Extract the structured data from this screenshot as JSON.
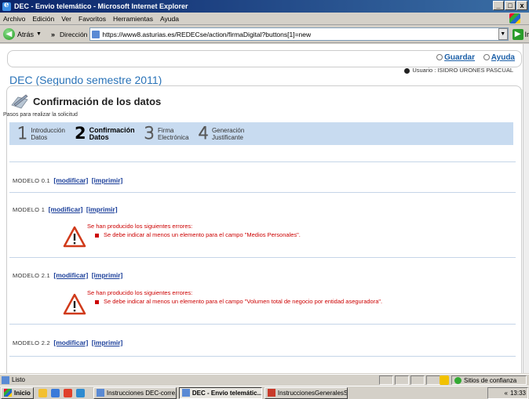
{
  "window": {
    "title": "DEC - Envio telemático - Microsoft Internet Explorer",
    "controls": {
      "minimize": "_",
      "maximize": "□",
      "close": "x"
    }
  },
  "menu": [
    "Archivo",
    "Edición",
    "Ver",
    "Favoritos",
    "Herramientas",
    "Ayuda"
  ],
  "toolbar": {
    "back_label": "Atrás",
    "more": "»",
    "address_label": "Dirección",
    "url": "https://www8.asturias.es/REDECse/action/firmaDigital?buttons[1]=new",
    "go_label": "Ir"
  },
  "page": {
    "top_links": {
      "save": "Guardar",
      "help": "Ayuda"
    },
    "user": "Usuario : ISIDRO URONES PASCUAL",
    "app_title": "DEC (Segundo semestre 2011)",
    "section_title": "Confirmación de los datos",
    "steps_caption": "Pasos para realizar la solicitud",
    "steps": [
      {
        "num": "1",
        "line1": "Introducción",
        "line2": "Datos"
      },
      {
        "num": "2",
        "line1": "Confirmación",
        "line2": "Datos"
      },
      {
        "num": "3",
        "line1": "Firma",
        "line2": "Electrónica"
      },
      {
        "num": "4",
        "line1": "Generación",
        "line2": "Justificante"
      }
    ],
    "link_modify": "[modificar]",
    "link_print": "[imprimir]",
    "models": [
      {
        "name": "MODELO 0.1"
      },
      {
        "name": "MODELO 1",
        "error_title": "Se han producido los siguientes errores:",
        "error": "Se debe indicar al menos un elemento para el campo \"Medios Personales\"."
      },
      {
        "name": "MODELO 2.1",
        "error_title": "Se han producido los siguientes errores:",
        "error": "Se debe indicar al menos un elemento para el campo \"Volumen total de negocio por entidad aseguradora\"."
      },
      {
        "name": "MODELO 2.2"
      }
    ]
  },
  "status": {
    "text": "Listo",
    "zone": "Sitios de confianza"
  },
  "taskbar": {
    "start": "Inicio",
    "tasks": [
      "Instrucciones DEC-corre...",
      "DEC - Envio telemátic...",
      "InstruccionesGeneralesS..."
    ],
    "clock": "13:33",
    "tray_chevron": "«"
  }
}
